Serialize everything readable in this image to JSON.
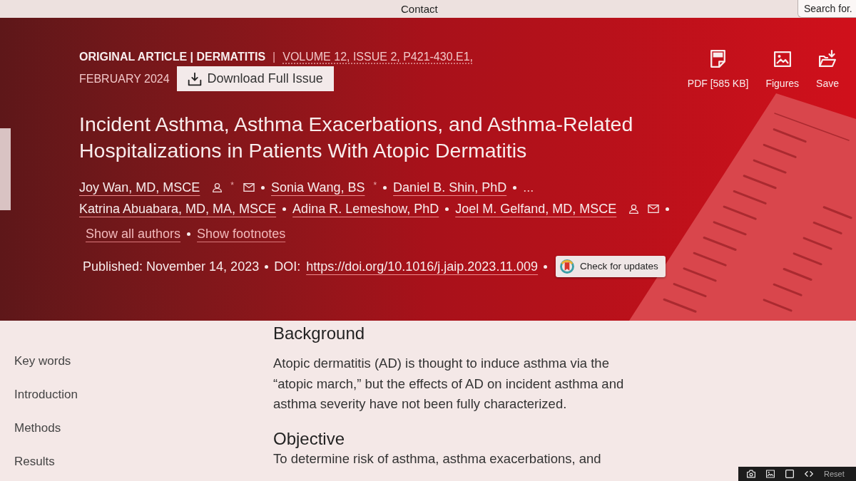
{
  "top_nav": {
    "links": [
      "Contact"
    ],
    "search": {
      "placeholder": "Search for."
    }
  },
  "article_header": {
    "section_label": "ORIGINAL ARTICLE | DERMATITIS",
    "divider": "|",
    "volume": "VOLUME 12, ISSUE 2, P421-430.E1,",
    "date": "FEBRUARY 2024",
    "download_button": "Download Full Issue",
    "actions": [
      {
        "kind": "pdf",
        "label": "PDF [585 KB]"
      },
      {
        "kind": "figures",
        "label": "Figures"
      },
      {
        "kind": "save",
        "label": "Save"
      }
    ],
    "title": "Incident Asthma, Asthma Exacerbations, and Asthma-Related Hospitalizations in Patients With Atopic Dermatitis",
    "author_rows": [
      {
        "authors": [
          {
            "name": "Joy Wan, MD, MSCE",
            "profile": true,
            "footnote": "*",
            "email": true
          },
          {
            "name": "Sonia Wang, BS",
            "profile": false,
            "footnote": "*",
            "email": false
          },
          {
            "name": "Daniel B. Shin, PhD",
            "profile": false,
            "email": false
          }
        ],
        "more": "..."
      },
      {
        "authors": [
          {
            "name": "Katrina Abuabara, MD, MA, MSCE",
            "profile": false,
            "email": false
          },
          {
            "name": "Adina R. Lemeshow, PhD",
            "profile": false,
            "email": false
          },
          {
            "name": "Joel M. Gelfand, MD, MSCE",
            "profile": true,
            "email": true
          }
        ]
      }
    ],
    "author_links": [
      "Show all authors",
      "Show footnotes"
    ],
    "published": "Published: November 14, 2023",
    "doi_label": "DOI:",
    "doi": "https://doi.org/10.1016/j.jaip.2023.11.009",
    "check_updates_button": "Check for updates"
  },
  "sidebar": {
    "items": [
      "Key words",
      "Introduction",
      "Methods",
      "Results"
    ]
  },
  "abstract": {
    "sections": [
      {
        "heading": "Background",
        "text": "Atopic dermatitis (AD) is thought to induce asthma via the “atopic march,” but the effects of AD on incident asthma and asthma severity have not been fully characterized."
      },
      {
        "heading": "Objective",
        "text": "To determine risk of asthma, asthma exacerbations, and"
      }
    ]
  },
  "bottom_toolbar": {
    "tools": [
      {
        "kind": "camera"
      },
      {
        "kind": "image"
      },
      {
        "kind": "square"
      },
      {
        "kind": "code"
      }
    ],
    "reset": "Reset"
  }
}
